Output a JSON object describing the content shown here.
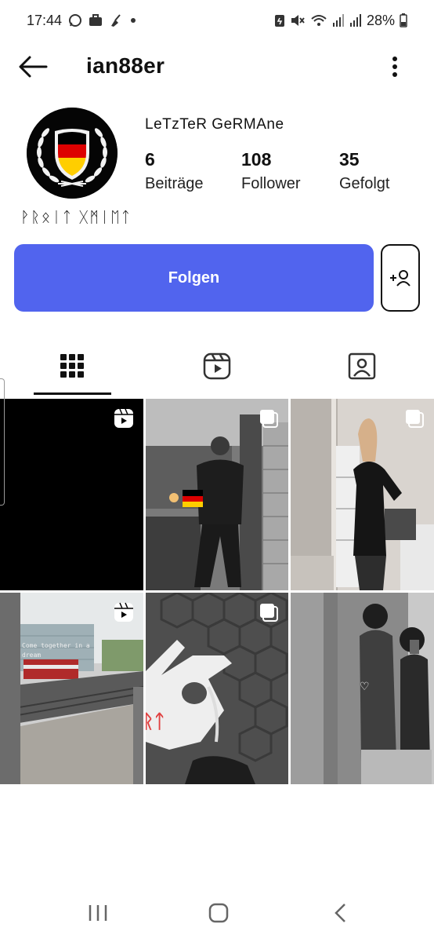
{
  "status_bar": {
    "time": "17:44",
    "battery": "28%",
    "left_icons": [
      "whatsapp-icon",
      "briefcase-icon",
      "broom-icon",
      "dot-icon"
    ],
    "right_icons": [
      "battery-saver-icon",
      "mute-icon",
      "wifi-icon",
      "signal-icon",
      "signal-icon",
      "battery-icon"
    ]
  },
  "header": {
    "username": "ian88er"
  },
  "profile": {
    "full_name": "LeTzTeR GeRMAne",
    "bio": "ᚹᚱᛟᛁᛏ ᚷᛗᛁᛖᛏ",
    "stats": [
      {
        "value": "6",
        "label": "Beiträge"
      },
      {
        "value": "108",
        "label": "Follower"
      },
      {
        "value": "35",
        "label": "Gefolgt"
      }
    ],
    "avatar_colors": {
      "black": "#000000",
      "red": "#dd0000",
      "gold": "#ffce00",
      "white": "#ffffff"
    }
  },
  "actions": {
    "follow_label": "Folgen",
    "accent_color": "#5164ee"
  },
  "tabs": [
    {
      "name": "grid",
      "icon": "grid-icon",
      "selected": true
    },
    {
      "name": "reels",
      "icon": "reels-icon",
      "selected": false
    },
    {
      "name": "tagged",
      "icon": "tagged-icon",
      "selected": false
    }
  ],
  "posts": [
    {
      "type": "reel",
      "badge_icon": "reel-badge-icon"
    },
    {
      "type": "carousel",
      "badge_icon": "carousel-icon"
    },
    {
      "type": "carousel",
      "badge_icon": "carousel-icon"
    },
    {
      "type": "reel",
      "badge_icon": "reel-badge-icon",
      "caption": "Come together in a\ndream"
    },
    {
      "type": "carousel",
      "badge_icon": "carousel-icon",
      "caption": "ᚱᛏ"
    },
    {
      "type": "photo",
      "badge_icon": "",
      "caption": "♡"
    }
  ]
}
